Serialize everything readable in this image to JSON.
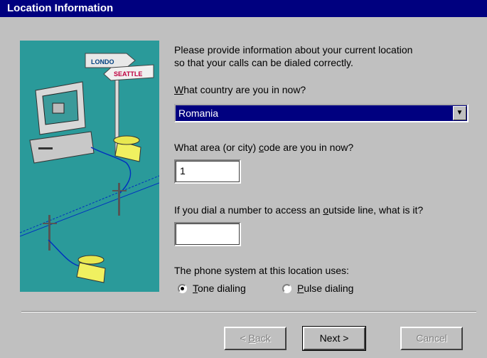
{
  "dialog": {
    "title": "Location Information",
    "intro_line1": "Please provide information about your current location",
    "intro_line2": "so that your calls can be dialed correctly."
  },
  "illustration": {
    "sign_top": "LONDO",
    "sign_bottom": "SEATTLE"
  },
  "country": {
    "label_underlined": "W",
    "label_rest": "hat country are you in now?",
    "selected": "Romania"
  },
  "area_code": {
    "label_before": "What area (or city) ",
    "label_underlined": "c",
    "label_after": "ode are you in now?",
    "value": "1"
  },
  "outside_line": {
    "label_before": "If you dial a number to access an ",
    "label_underlined": "o",
    "label_after": "utside line, what is it?",
    "value": ""
  },
  "phone_system": {
    "label": "The phone system at this location uses:",
    "tone_underlined": "T",
    "tone_rest": "one dialing",
    "pulse_underlined": "P",
    "pulse_rest": "ulse dialing",
    "selected": "tone"
  },
  "buttons": {
    "back_prefix": "< ",
    "back_underlined": "B",
    "back_rest": "ack",
    "next": "Next >",
    "cancel": "Cancel"
  }
}
